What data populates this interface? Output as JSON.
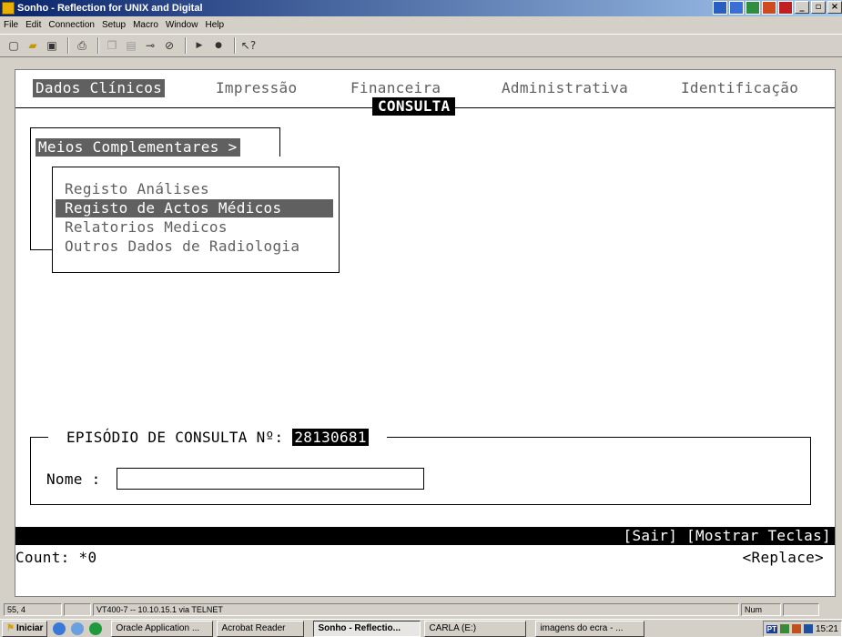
{
  "window": {
    "title": "Sonho - Reflection for UNIX and Digital"
  },
  "menu": [
    "File",
    "Edit",
    "Connection",
    "Setup",
    "Macro",
    "Window",
    "Help"
  ],
  "toolbar_icons": [
    "new-icon",
    "open-icon",
    "save-icon",
    "print-icon",
    "copy-icon",
    "paste-icon",
    "connect-icon",
    "disconnect-icon",
    "play-icon",
    "record-icon",
    "help-pointer-icon"
  ],
  "terminal": {
    "tabs": [
      "Dados Clínicos",
      "Impressão",
      "Financeira",
      "Administrativa",
      "Identificação"
    ],
    "active_tab": "Dados Clínicos",
    "section_title": "CONSULTA",
    "submenu_label": "Meios Complementares >",
    "submenu_items": [
      "Registo Análises",
      "Registo de Actos Médicos",
      "Relatorios Medicos",
      "Outros Dados de Radiologia"
    ],
    "selected_item": "Registo de Actos Médicos",
    "episode_label": "EPISÓDIO DE CONSULTA Nº:",
    "episode_number": "28130681",
    "nome_label": "Nome :",
    "nome_value": "",
    "function_keys": "[Sair] [Mostrar Teclas]",
    "count_label": "Count: *0",
    "replace_label": "<Replace>"
  },
  "statusbar": {
    "cursor": "55, 4",
    "connection": "VT400-7 -- 10.10.15.1 via TELNET",
    "num": "Num"
  },
  "taskbar": {
    "start_label": "Iniciar",
    "tasks": [
      "Oracle Application ...",
      "Acrobat Reader",
      "Sonho - Reflectio...",
      "CARLA (E:)",
      "imagens do ecra - ..."
    ],
    "active_task": "Sonho - Reflectio...",
    "tray_text": "PT",
    "clock": "15:21"
  }
}
